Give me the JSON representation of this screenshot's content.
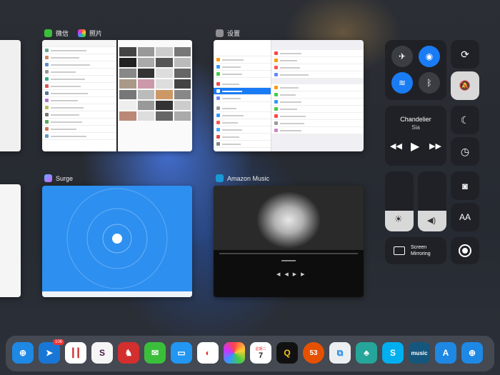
{
  "apps": {
    "wechat": {
      "label": "微信"
    },
    "photos": {
      "label": "照片"
    },
    "settings": {
      "label": "设置"
    },
    "surge": {
      "label": "Surge"
    },
    "amazon": {
      "label": "Amazon Music"
    }
  },
  "control_center": {
    "now_playing": {
      "title": "Chandelier",
      "artist": "Sia"
    },
    "screen_mirroring": {
      "label_line1": "Screen",
      "label_line2": "Mirroring"
    },
    "text_size": {
      "label": "AA"
    },
    "volume_level": 0.35,
    "brightness_level": 0.35
  },
  "dock": {
    "icons": [
      {
        "name": "safari"
      },
      {
        "name": "spark",
        "badge": "106"
      },
      {
        "name": "voice-memos"
      },
      {
        "name": "slack"
      },
      {
        "name": "mail-horse"
      },
      {
        "name": "wechat"
      },
      {
        "name": "files"
      },
      {
        "name": "weibo"
      },
      {
        "name": "photos"
      },
      {
        "name": "calendar",
        "day_label": "星期二",
        "day": "7"
      },
      {
        "name": "q-app",
        "letter": "Q"
      },
      {
        "name": "app-53",
        "letter": "53"
      },
      {
        "name": "copy-app"
      },
      {
        "name": "tree-app"
      },
      {
        "name": "skype",
        "letter": "S"
      },
      {
        "name": "amazon-music",
        "letter": "music"
      },
      {
        "name": "app-store"
      },
      {
        "name": "safari-2"
      }
    ]
  },
  "colors": {
    "accent": "#1a7cf5",
    "surge_blue": "#2d8ff0"
  }
}
